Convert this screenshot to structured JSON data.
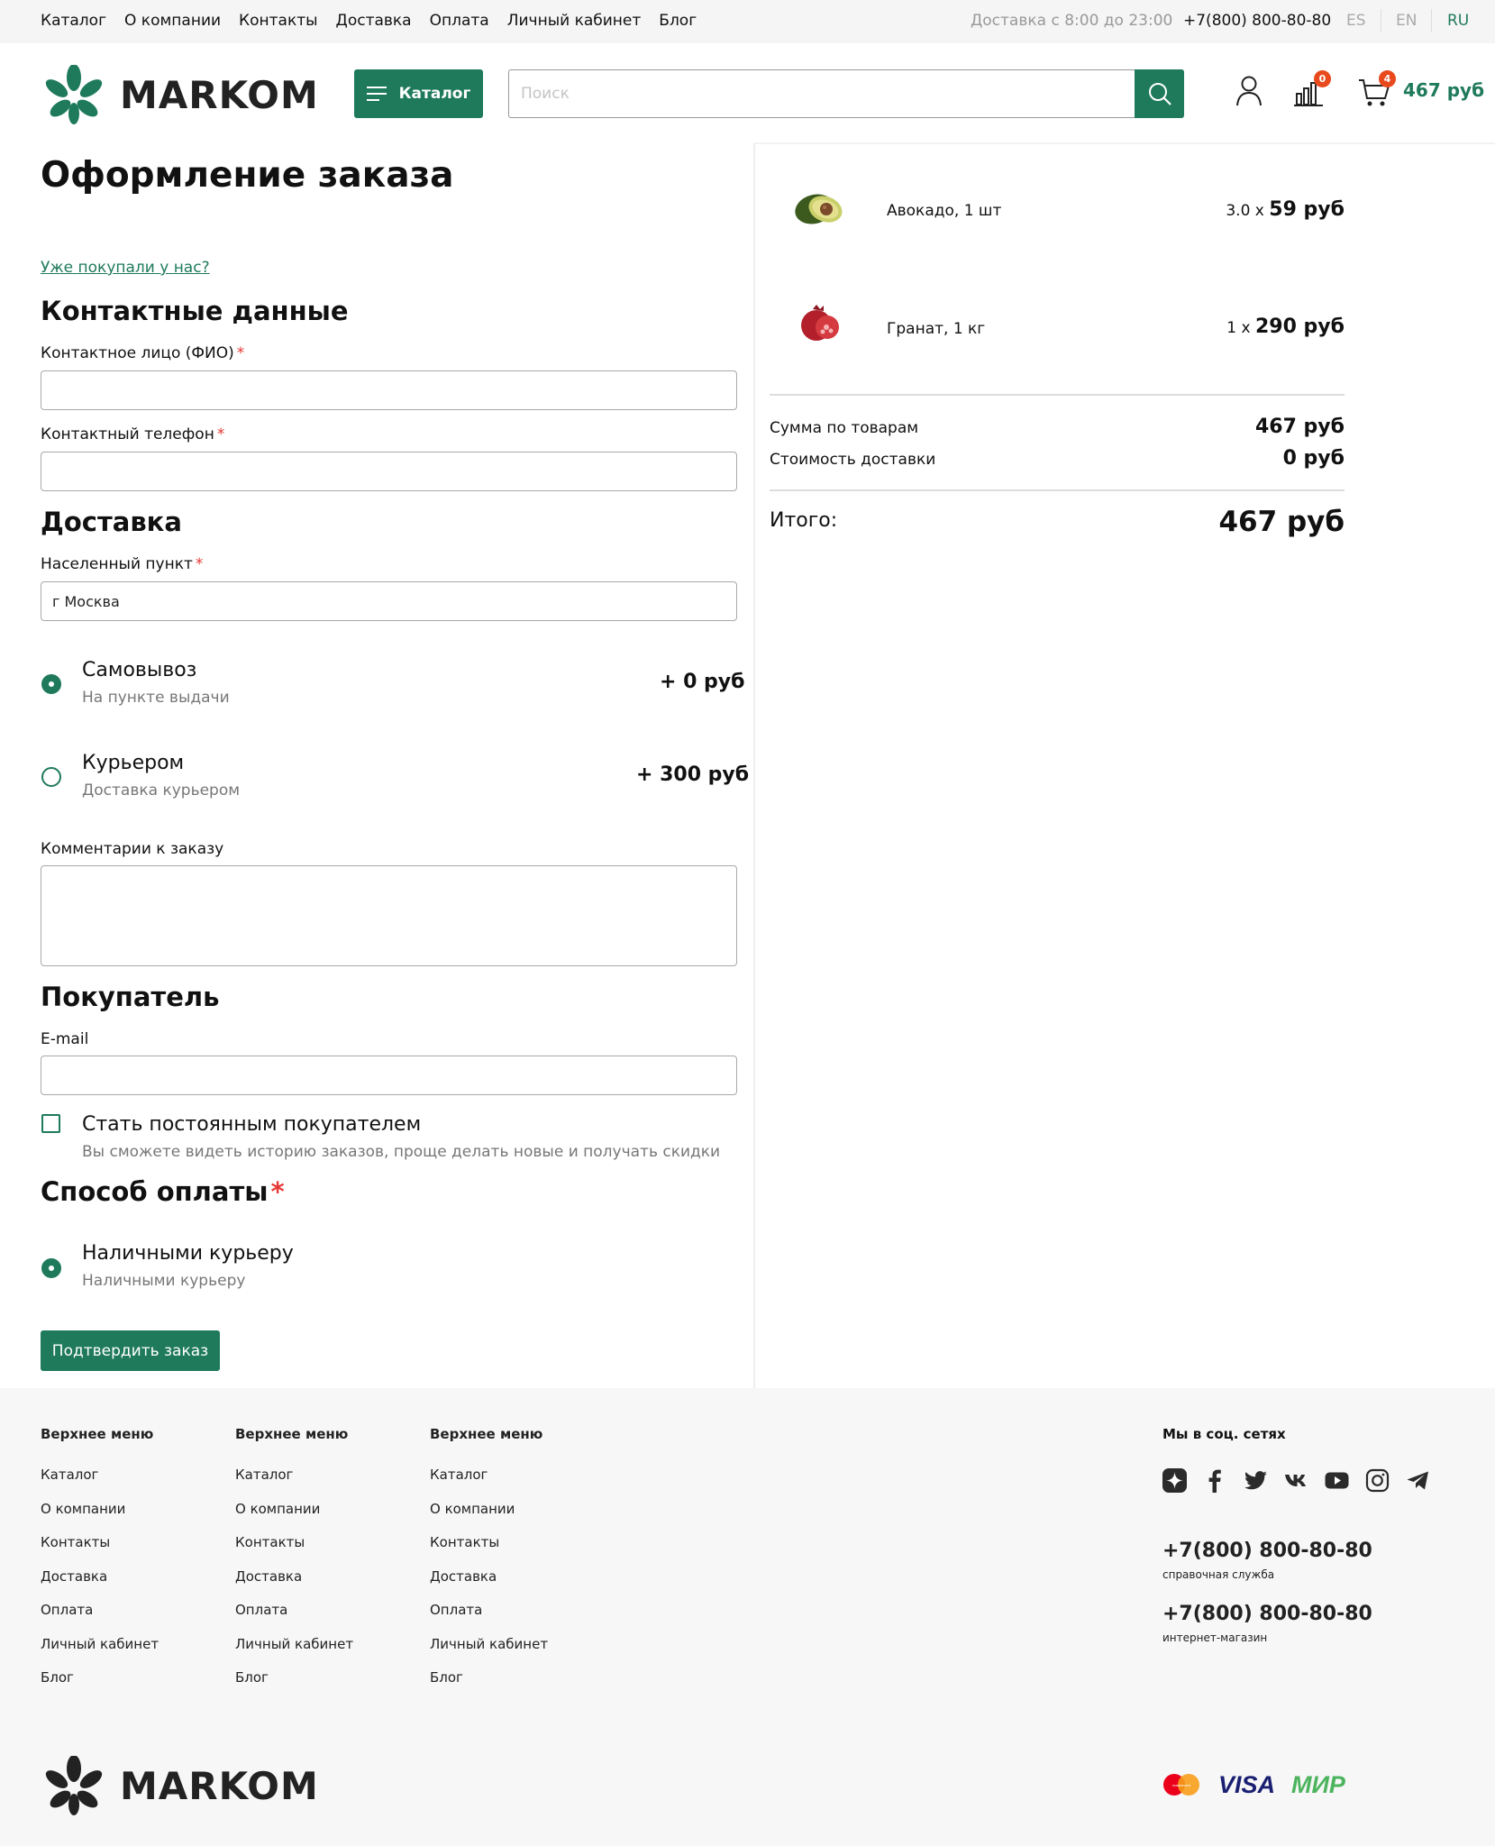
{
  "topbar": {
    "nav": [
      "Каталог",
      "О компании",
      "Контакты",
      "Доставка",
      "Оплата",
      "Личный кабинет",
      "Блог"
    ],
    "delivery_hours": "Доставка с 8:00 до 23:00",
    "phone": "+7(800) 800-80-80",
    "languages": [
      "ES",
      "EN",
      "RU"
    ],
    "active_language": "RU"
  },
  "header": {
    "logo": "MARKOM",
    "catalog_button": "Каталог",
    "search_placeholder": "Поиск",
    "compare_count": "0",
    "cart_count": "4",
    "cart_total": "467 руб"
  },
  "checkout": {
    "title": "Оформление заказа",
    "already_bought_link": "Уже покупали у нас?",
    "contacts": {
      "title": "Контактные данные",
      "name_label": "Контактное лицо (ФИО)",
      "phone_label": "Контактный телефон",
      "required_mark": "*"
    },
    "delivery": {
      "title": "Доставка",
      "city_label": "Населенный пункт",
      "city_value": "г Москва",
      "options": [
        {
          "title": "Самовывоз",
          "subtitle": "На пункте выдачи",
          "price": "+ 0 руб",
          "selected": true
        },
        {
          "title": "Курьером",
          "subtitle": "Доставка курьером",
          "price": "+ 300 руб",
          "selected": false
        }
      ],
      "comment_label": "Комментарии к заказу"
    },
    "buyer": {
      "title": "Покупатель",
      "email_label": "E-mail",
      "regular_customer_label": "Стать постоянным покупателем",
      "regular_customer_hint": "Вы сможете видеть историю заказов, проще делать новые и получать скидки",
      "regular_customer_checked": false
    },
    "payment": {
      "title": "Способ оплаты",
      "options": [
        {
          "title": "Наличными курьеру",
          "subtitle": "Наличными курьеру",
          "selected": true
        }
      ]
    },
    "confirm_button": "Подтвердить заказ"
  },
  "summary": {
    "items": [
      {
        "name": "Авокадо, 1 шт",
        "qty": "3.0 x",
        "price": "59 руб"
      },
      {
        "name": "Гранат, 1 кг",
        "qty": "1 x",
        "price": "290 руб"
      }
    ],
    "goods_sum_label": "Сумма по товарам",
    "goods_sum": "467 руб",
    "delivery_cost_label": "Стоимость доставки",
    "delivery_cost": "0 руб",
    "total_label": "Итого:",
    "total": "467 руб"
  },
  "footer": {
    "columns": [
      {
        "title": "Верхнее меню",
        "items": [
          "Каталог",
          "О компании",
          "Контакты",
          "Доставка",
          "Оплата",
          "Личный кабинет",
          "Блог"
        ]
      },
      {
        "title": "Верхнее меню",
        "items": [
          "Каталог",
          "О компании",
          "Контакты",
          "Доставка",
          "Оплата",
          "Личный кабинет",
          "Блог"
        ]
      },
      {
        "title": "Верхнее меню",
        "items": [
          "Каталог",
          "О компании",
          "Контакты",
          "Доставка",
          "Оплата",
          "Личный кабинет",
          "Блог"
        ]
      }
    ],
    "social_title": "Мы в соц. сетях",
    "social_icons": [
      "yandex-zen-icon",
      "facebook-icon",
      "twitter-icon",
      "vk-icon",
      "youtube-icon",
      "instagram-icon",
      "telegram-icon"
    ],
    "phones": [
      {
        "number": "+7(800) 800-80-80",
        "caption": "справочная служба"
      },
      {
        "number": "+7(800) 800-80-80",
        "caption": "интернет-магазин"
      }
    ],
    "logo": "MARKOM",
    "payment_logos": [
      "mastercard",
      "VISA",
      "МИР"
    ]
  },
  "colors": {
    "accent": "#1f7a5c",
    "badge": "#e8491d",
    "required": "#e53935"
  }
}
